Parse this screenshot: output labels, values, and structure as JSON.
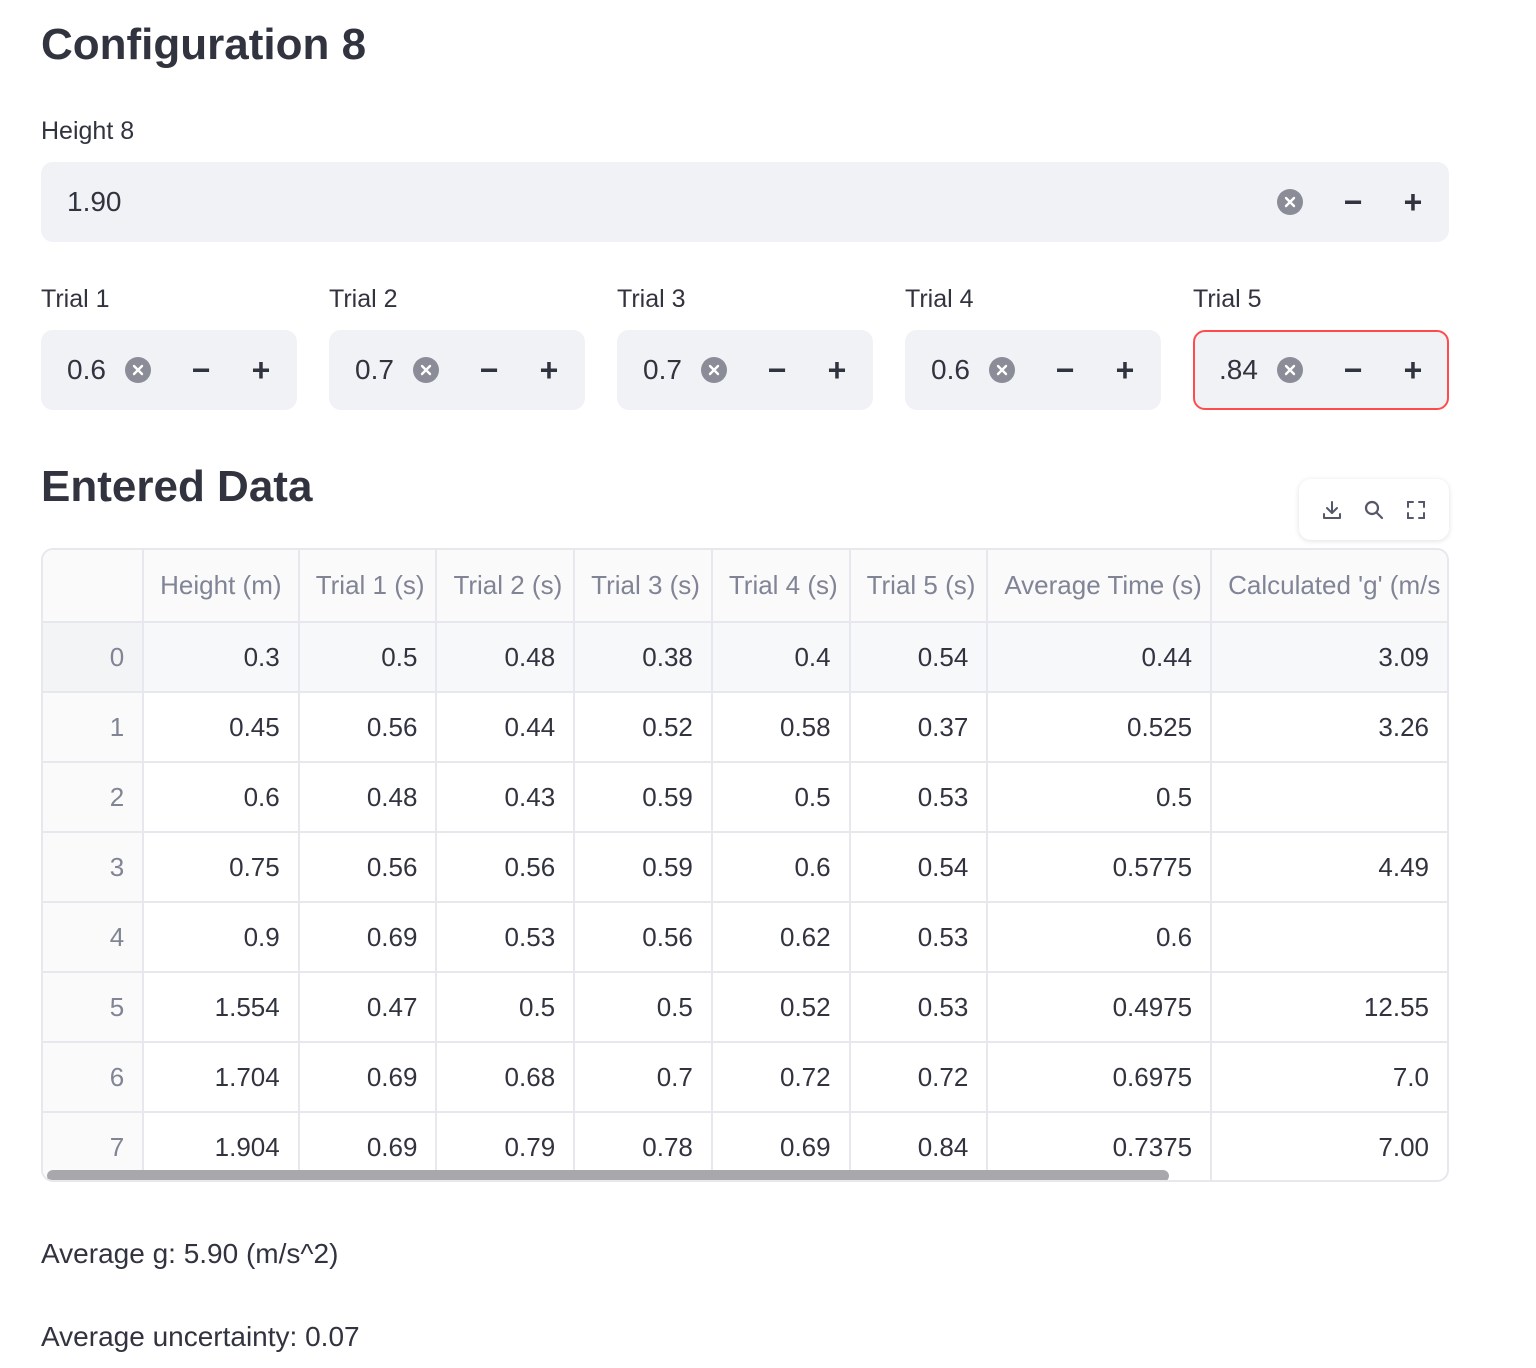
{
  "title": "Configuration 8",
  "height_input": {
    "label": "Height 8",
    "value": "1.90"
  },
  "trials": [
    {
      "label": "Trial 1",
      "value": "0.6"
    },
    {
      "label": "Trial 2",
      "value": "0.7"
    },
    {
      "label": "Trial 3",
      "value": "0.7"
    },
    {
      "label": "Trial 4",
      "value": "0.6"
    },
    {
      "label": "Trial 5",
      "value": ".84"
    }
  ],
  "section_title": "Entered Data",
  "toolbar": {
    "icons": [
      "download-icon",
      "search-icon",
      "fullscreen-icon"
    ]
  },
  "table": {
    "columns": [
      "",
      "Height (m)",
      "Trial 1 (s)",
      "Trial 2 (s)",
      "Trial 3 (s)",
      "Trial 4 (s)",
      "Trial 5 (s)",
      "Average Time (s)",
      "Calculated 'g' (m/s"
    ],
    "rows": [
      [
        "0",
        "0.3",
        "0.5",
        "0.48",
        "0.38",
        "0.4",
        "0.54",
        "0.44",
        "3.09"
      ],
      [
        "1",
        "0.45",
        "0.56",
        "0.44",
        "0.52",
        "0.58",
        "0.37",
        "0.525",
        "3.26"
      ],
      [
        "2",
        "0.6",
        "0.48",
        "0.43",
        "0.59",
        "0.5",
        "0.53",
        "0.5",
        ""
      ],
      [
        "3",
        "0.75",
        "0.56",
        "0.56",
        "0.59",
        "0.6",
        "0.54",
        "0.5775",
        "4.49"
      ],
      [
        "4",
        "0.9",
        "0.69",
        "0.53",
        "0.56",
        "0.62",
        "0.53",
        "0.6",
        ""
      ],
      [
        "5",
        "1.554",
        "0.47",
        "0.5",
        "0.5",
        "0.52",
        "0.53",
        "0.4975",
        "12.55"
      ],
      [
        "6",
        "1.704",
        "0.69",
        "0.68",
        "0.7",
        "0.72",
        "0.72",
        "0.6975",
        "7.0"
      ],
      [
        "7",
        "1.904",
        "0.69",
        "0.79",
        "0.78",
        "0.69",
        "0.84",
        "0.7375",
        "7.00"
      ]
    ]
  },
  "summary": {
    "average_g": "Average g: 5.90 (m/s^2)",
    "average_uncertainty": "Average uncertainty: 0.07"
  },
  "colors": {
    "input_bg": "#f0f2f6",
    "invalid_border": "#ff4b4b",
    "text": "#31333f",
    "muted": "#808495"
  }
}
